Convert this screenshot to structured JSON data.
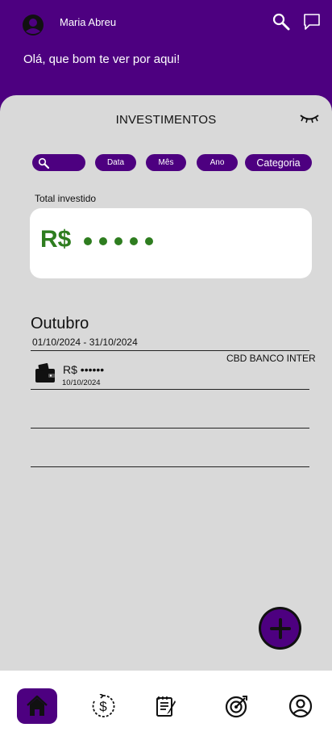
{
  "header": {
    "user_name": "Maria Abreu",
    "greeting": "Olá, que bom te ver por aqui!",
    "icons": [
      "avatar-icon",
      "search-icon",
      "chat-icon"
    ]
  },
  "panel": {
    "title": "INVESTIMENTOS",
    "filters": {
      "data": "Data",
      "mes": "Mês",
      "ano": "Ano",
      "categoria": "Categoria"
    },
    "total": {
      "label": "Total investido",
      "currency": "R$"
    },
    "month": {
      "title": "Outubro",
      "range": "01/10/2024 - 31/10/2024"
    },
    "transaction": {
      "tags": "CBD  BANCO INTER",
      "amount": "R$  ••••••",
      "date": "10/10/2024"
    }
  },
  "bottom_nav": {
    "items": [
      "home-icon",
      "money-cycle-icon",
      "notes-icon",
      "target-icon",
      "profile-icon"
    ],
    "active": "home-icon"
  },
  "colors": {
    "brand": "#4d0080",
    "money_green": "#2e7d1f",
    "background": "#d9d9d9"
  }
}
